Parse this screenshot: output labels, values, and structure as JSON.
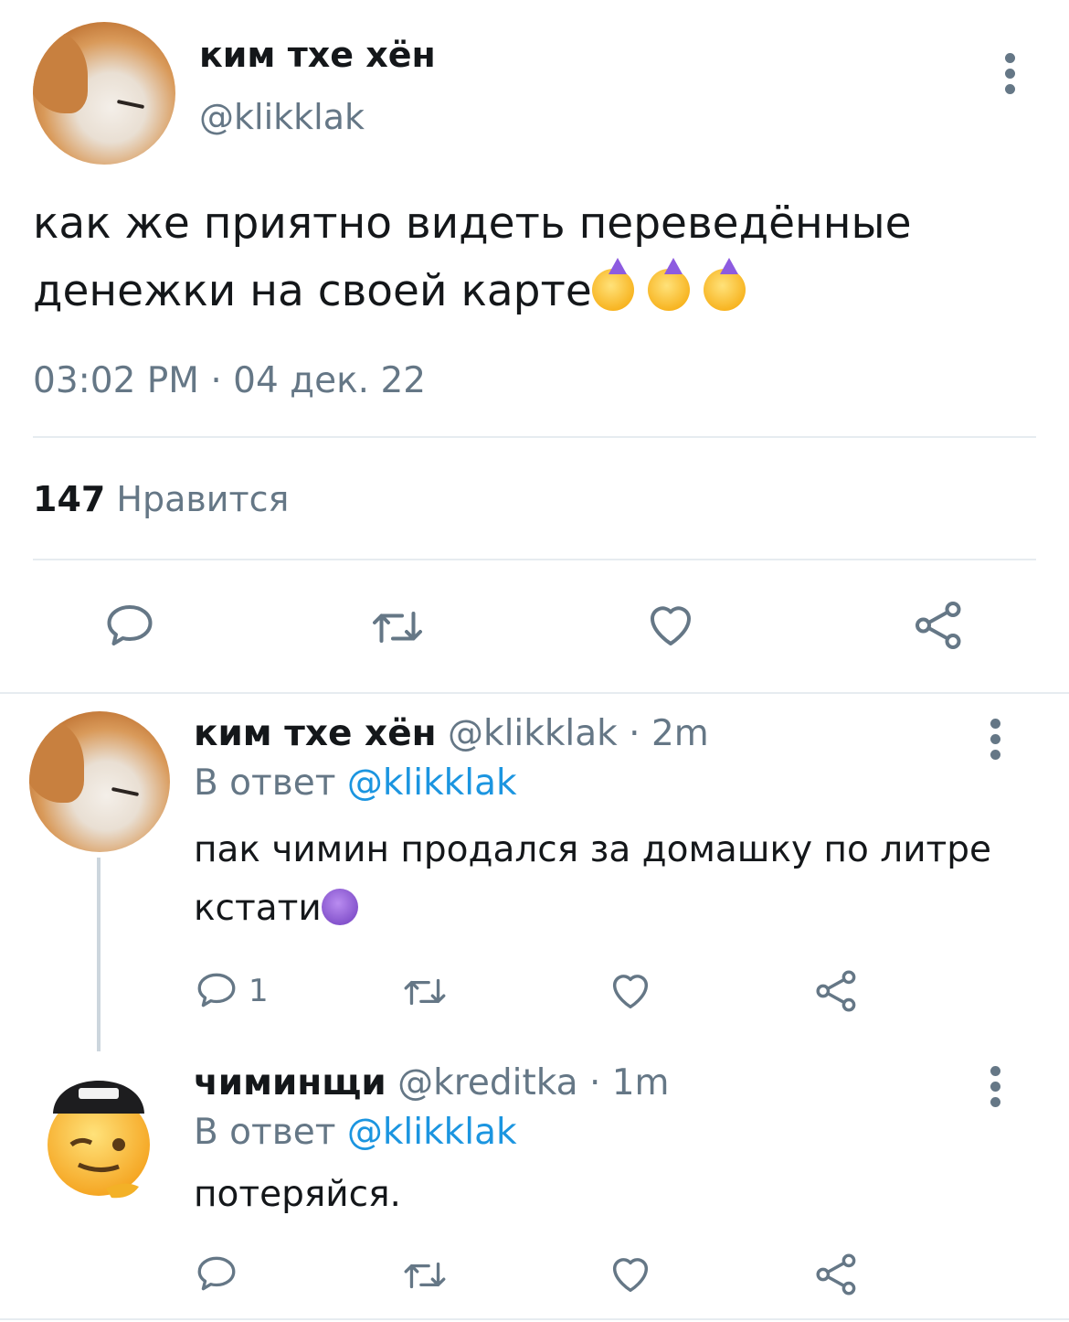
{
  "main_tweet": {
    "author_name": "ким тхе хён",
    "author_handle": "@klikklak",
    "text": "как же приятно видеть переведённые денежки на своей карте",
    "text_line1": "как же приятно видеть переведённые",
    "text_line2": "денежки на своей карте",
    "emojis": [
      "partying-face",
      "partying-face",
      "partying-face"
    ],
    "timestamp": "03:02 PM · 04 дек. 22",
    "likes_count": "147",
    "likes_label": "Нравится"
  },
  "replies": [
    {
      "author_name": "ким тхе хён",
      "author_handle": "@klikklak",
      "time": "· 2m",
      "reply_prefix": "В ответ",
      "reply_to": "@klikklak",
      "text_line1": "пак чимин продался за домашку по литре",
      "text_line2": "кстати",
      "emoji": "smiling-devil",
      "reply_count": "1"
    },
    {
      "author_name": "чиминщи",
      "author_handle": "@kreditka",
      "time": "· 1m",
      "reply_prefix": "В ответ",
      "reply_to": "@klikklak",
      "text_line1": "потеряйся."
    }
  ],
  "colors": {
    "accent": "#1b95e0",
    "text": "#14171a",
    "secondary": "#657786",
    "divider": "#e6ecf0"
  }
}
